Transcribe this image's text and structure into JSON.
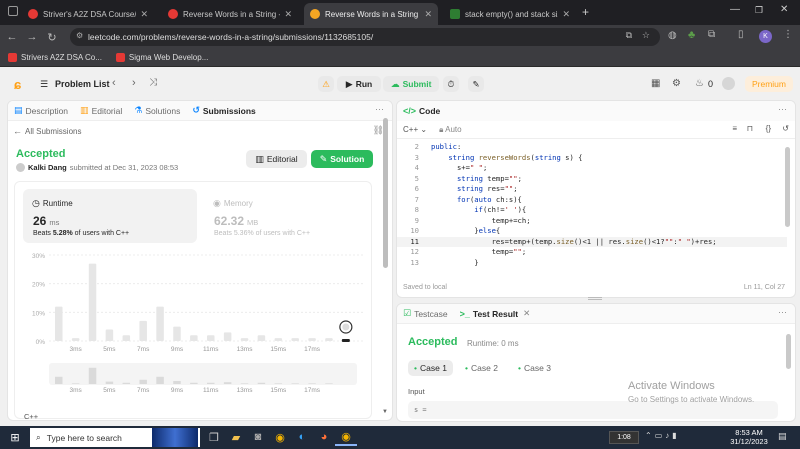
{
  "browser": {
    "tabs": [
      {
        "title": "Striver's A2Z DSA Course/Sheet",
        "favicon_color": "#e53935",
        "active": false
      },
      {
        "title": "Reverse Words in a String - [Up",
        "favicon_color": "#e53935",
        "active": false
      },
      {
        "title": "Reverse Words in a String - Lee",
        "favicon_color": "#f5a623",
        "active": true
      },
      {
        "title": "stack empty() and stack size() in",
        "favicon_color": "#2e7d32",
        "active": false
      }
    ],
    "url": "leetcode.com/problems/reverse-words-in-a-string/submissions/1132685105/",
    "profile_initial": "K",
    "bookmarks": [
      {
        "label": "Strivers A2Z DSA Co...",
        "color": "#e53935"
      },
      {
        "label": "Sigma Web Develop...",
        "color": "#e53935"
      }
    ]
  },
  "topbar": {
    "problem_list": "Problem List",
    "run": "Run",
    "submit": "Submit",
    "streak": "0",
    "premium": "Premium"
  },
  "left": {
    "tabs": [
      "Description",
      "Editorial",
      "Solutions",
      "Submissions"
    ],
    "all_submissions": "All Submissions",
    "status": "Accepted",
    "author": "Kalki Dang",
    "submitted_at": "submitted at Dec 31, 2023 08:53",
    "editorial_btn": "Editorial",
    "solution_btn": "Solution",
    "runtime_label": "Runtime",
    "runtime_value": "26",
    "runtime_unit": "ms",
    "runtime_beats_prefix": "Beats ",
    "runtime_beats_pct": "5.28%",
    "runtime_beats_suffix": " of users with C++",
    "memory_label": "Memory",
    "memory_value": "62.32",
    "memory_unit": "MB",
    "memory_beats": "Beats 5.36% of users with C++",
    "lang_footer": "C++"
  },
  "chart_data": {
    "type": "bar",
    "y_ticks": [
      "30%",
      "20%",
      "10%",
      "0%"
    ],
    "ylim": [
      0,
      30
    ],
    "x_tick_labels": [
      "3ms",
      "5ms",
      "7ms",
      "9ms",
      "11ms",
      "13ms",
      "15ms",
      "17ms"
    ],
    "values": [
      12,
      1,
      27,
      4,
      2,
      7,
      12,
      5,
      2,
      2,
      3,
      1,
      2,
      1,
      1,
      1,
      1
    ],
    "highlight_index": 17,
    "mini_x_tick_labels": [
      "3ms",
      "5ms",
      "7ms",
      "9ms",
      "11ms",
      "13ms",
      "15ms",
      "17ms"
    ]
  },
  "code": {
    "header": "Code",
    "language": "C++",
    "mode": "Auto",
    "lines": [
      {
        "n": "2",
        "html": "<span class='kw'>public</span>:"
      },
      {
        "n": "3",
        "html": "    <span class='kw'>string</span> <span class='fn'>reverseWords</span>(<span class='kw'>string</span> s) {"
      },
      {
        "n": "4",
        "html": "      s+=<span class='st'>\" \"</span>;"
      },
      {
        "n": "5",
        "html": "      <span class='kw'>string</span> temp=<span class='st'>\"\"</span>;"
      },
      {
        "n": "6",
        "html": "      <span class='kw'>string</span> res=<span class='st'>\"\"</span>;"
      },
      {
        "n": "7",
        "html": "      <span class='kw'>for</span>(<span class='kw'>auto</span> ch:s){"
      },
      {
        "n": "8",
        "html": "          <span class='kw'>if</span>(ch!=<span class='st'>' '</span>){"
      },
      {
        "n": "9",
        "html": "              temp+=ch;"
      },
      {
        "n": "10",
        "html": "          }<span class='kw'>else</span>{"
      },
      {
        "n": "11",
        "html": "              res=temp+(temp.<span class='fn'>size</span>()&lt;1 || res.<span class='fn'>size</span>()&lt;1?<span class='st'>\"\"</span>:<span class='st'>\" \"</span>)+res;"
      },
      {
        "n": "12",
        "html": "              temp=<span class='st'>\"\"</span>;"
      },
      {
        "n": "13",
        "html": "          }"
      }
    ],
    "saved": "Saved to local",
    "cursor": "Ln 11, Col 27"
  },
  "result": {
    "tabs": [
      "Testcase",
      "Test Result"
    ],
    "status": "Accepted",
    "runtime": "Runtime: 0 ms",
    "cases": [
      "Case 1",
      "Case 2",
      "Case 3"
    ],
    "input_label": "Input",
    "input_value": "s ="
  },
  "watermark": {
    "line1": "Activate Windows",
    "line2": "Go to Settings to activate Windows."
  },
  "taskbar": {
    "search": "Type here to search",
    "media_time": "1:08",
    "time": "8:53 AM",
    "date": "31/12/2023"
  },
  "colors": {
    "accent_green": "#2cbb5d",
    "accent_orange": "#ffa116",
    "link_blue": "#0a84ff"
  }
}
